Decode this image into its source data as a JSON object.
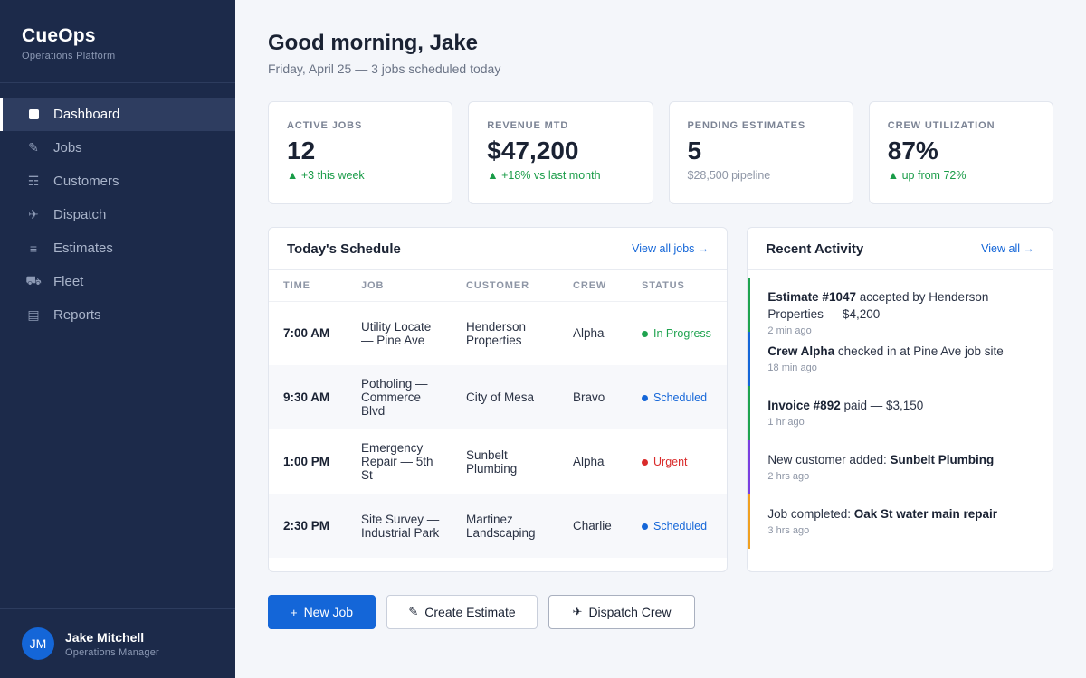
{
  "app": {
    "name": "CueOps",
    "subtitle": "Operations Platform"
  },
  "nav": [
    {
      "label": "Dashboard",
      "icon": "dashboard-icon",
      "active": true
    },
    {
      "label": "Jobs",
      "icon": "wrench-icon"
    },
    {
      "label": "Customers",
      "icon": "customers-icon"
    },
    {
      "label": "Dispatch",
      "icon": "plane-icon"
    },
    {
      "label": "Estimates",
      "icon": "list-icon"
    },
    {
      "label": "Fleet",
      "icon": "truck-icon"
    },
    {
      "label": "Reports",
      "icon": "report-icon"
    }
  ],
  "user": {
    "initials": "JM",
    "name": "Jake Mitchell",
    "role": "Operations Manager"
  },
  "header": {
    "greeting": "Good morning, Jake",
    "subline": "Friday, April 25 — 3 jobs scheduled today"
  },
  "stats": [
    {
      "label": "ACTIVE JOBS",
      "value": "12",
      "delta": "▲ +3 this week",
      "muted": false
    },
    {
      "label": "REVENUE MTD",
      "value": "$47,200",
      "delta": "▲ +18% vs last month",
      "muted": false
    },
    {
      "label": "PENDING ESTIMATES",
      "value": "5",
      "delta": "$28,500 pipeline",
      "muted": true
    },
    {
      "label": "CREW UTILIZATION",
      "value": "87%",
      "delta": "▲ up from 72%",
      "muted": false
    }
  ],
  "schedule": {
    "title": "Today's Schedule",
    "link": "View all jobs →",
    "columns": [
      "TIME",
      "JOB",
      "CUSTOMER",
      "CREW",
      "STATUS"
    ],
    "rows": [
      {
        "time": "7:00 AM",
        "job": "Utility Locate — Pine Ave",
        "customer": "Henderson Properties",
        "crew": "Alpha",
        "status": "In Progress",
        "color": "#1fa34f"
      },
      {
        "time": "9:30 AM",
        "job": "Potholing — Commerce Blvd",
        "customer": "City of Mesa",
        "crew": "Bravo",
        "status": "Scheduled",
        "color": "#1466d8"
      },
      {
        "time": "1:00 PM",
        "job": "Emergency Repair — 5th St",
        "customer": "Sunbelt Plumbing",
        "crew": "Alpha",
        "status": "Urgent",
        "color": "#d92b2b"
      },
      {
        "time": "2:30 PM",
        "job": "Site Survey — Industrial Park",
        "customer": "Martinez Landscaping",
        "crew": "Charlie",
        "status": "Scheduled",
        "color": "#1466d8"
      }
    ]
  },
  "activity": {
    "title": "Recent Activity",
    "link": "View all →",
    "items": [
      {
        "bold": "Estimate #1047",
        "text": " accepted by Henderson Properties — $4,200",
        "boldFirst": true,
        "time": "2 min ago",
        "color": "green"
      },
      {
        "bold": "Crew Alpha",
        "text": " checked in at Pine Ave job site",
        "boldFirst": true,
        "time": "18 min ago",
        "color": "blue"
      },
      {
        "bold": "Invoice #892",
        "text": " paid — $3,150",
        "boldFirst": true,
        "time": "1 hr ago",
        "color": "green"
      },
      {
        "bold": "Sunbelt Plumbing",
        "text": "New customer added: ",
        "boldFirst": false,
        "time": "2 hrs ago",
        "color": "purple"
      },
      {
        "bold": "Oak St water main repair",
        "text": "Job completed: ",
        "boldFirst": false,
        "time": "3 hrs ago",
        "color": "orange"
      }
    ]
  },
  "actions": {
    "new_job": "New Job",
    "create_estimate": "Create Estimate",
    "dispatch_crew": "Dispatch Crew"
  }
}
